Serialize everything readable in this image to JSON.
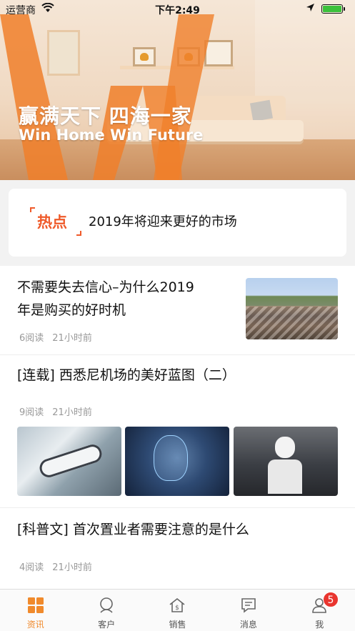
{
  "status_bar": {
    "carrier": "运营商",
    "time": "下午2:49"
  },
  "banner": {
    "title": "赢满天下 四海一家",
    "subtitle": "Win Home Win Future"
  },
  "hot": {
    "tag": "热点",
    "headline": "2019年将迎来更好的市场"
  },
  "articles": [
    {
      "title_line1": "不需要失去信心–为什么2019",
      "title_line2": "年是购买的好时机",
      "reads": "6阅读",
      "time": "21小时前"
    },
    {
      "title": "[连载] 西悉尼机场的美好蓝图（二）",
      "reads": "9阅读",
      "time": "21小时前"
    },
    {
      "title": "[科普文] 首次置业者需要注意的是什么",
      "reads": "4阅读",
      "time": "21小时前"
    }
  ],
  "tabs": [
    {
      "label": "资讯",
      "icon": "grid-icon",
      "active": true
    },
    {
      "label": "客户",
      "icon": "user-circle-icon",
      "active": false
    },
    {
      "label": "销售",
      "icon": "house-dollar-icon",
      "active": false
    },
    {
      "label": "消息",
      "icon": "message-icon",
      "active": false
    },
    {
      "label": "我",
      "icon": "person-icon",
      "active": false
    }
  ],
  "profile_badge": "5",
  "colors": {
    "accent": "#f08a2c",
    "hot": "#ef5a2a",
    "badge": "#e9352f"
  }
}
